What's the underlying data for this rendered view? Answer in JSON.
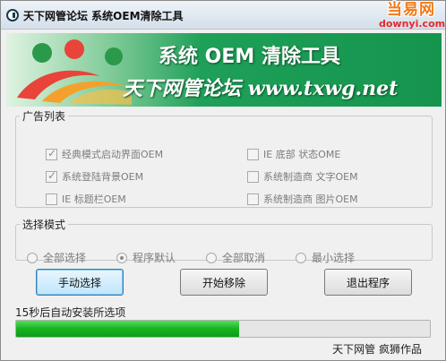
{
  "window": {
    "title": "天下网管论坛 系统OEM清除工具"
  },
  "watermark": {
    "top": "当易网",
    "bottom": "downyi.com"
  },
  "banner": {
    "title": "系统 OEM 清除工具",
    "subtitle": "天下网管论坛 www.txwg.net"
  },
  "ads_group": {
    "legend": "广告列表",
    "items": [
      {
        "label": "经典模式启动界面OEM",
        "checked": true
      },
      {
        "label": "IE 底部 状态OME",
        "checked": false
      },
      {
        "label": "系统登陆背景OEM",
        "checked": true
      },
      {
        "label": "系统制造商 文字OEM",
        "checked": false
      },
      {
        "label": "IE 标题栏OEM",
        "checked": false
      },
      {
        "label": "系统制造商 图片OEM",
        "checked": false
      }
    ]
  },
  "mode_group": {
    "legend": "选择模式",
    "options": [
      {
        "label": "全部选择",
        "selected": false
      },
      {
        "label": "程序默认",
        "selected": true
      },
      {
        "label": "全部取消",
        "selected": false
      },
      {
        "label": "最小选择",
        "selected": false
      }
    ]
  },
  "buttons": {
    "manual": "手动选择",
    "start": "开始移除",
    "exit": "退出程序"
  },
  "status": {
    "label": "15秒后自动安装所选项",
    "progress": 0.54
  },
  "credit": "天下网管  疯狮作品",
  "colors": {
    "banner_green": "#15944d",
    "progress_green": "#18b322",
    "logo_red": "#e8443a",
    "logo_green": "#2a9a4a",
    "logo_orange": "#f3a12c"
  }
}
